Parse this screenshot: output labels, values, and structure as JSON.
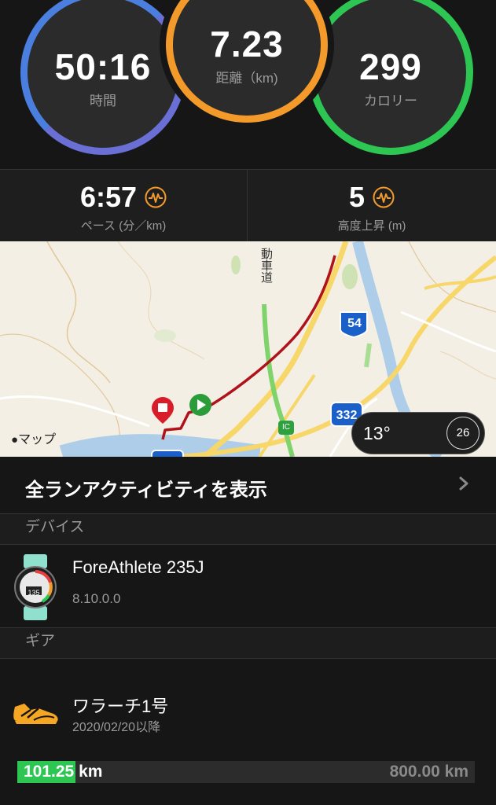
{
  "top_progress": 0.25,
  "summary": {
    "time": {
      "value": "50:16",
      "label": "時間"
    },
    "distance": {
      "value": "7.23",
      "label": "距離（km)"
    },
    "calories": {
      "value": "299",
      "label": "カロリー"
    }
  },
  "stats": {
    "pace": {
      "value": "6:57",
      "label": "ペース (分／km)",
      "icon": "elevation-wave-icon"
    },
    "elevation": {
      "value": "5",
      "label": "高度上昇 (m)",
      "icon": "elevation-wave-icon"
    }
  },
  "map": {
    "credit": "マップ",
    "road_labels": [
      "54",
      "332",
      "IC"
    ],
    "road_vertical_text": "動車道",
    "weather": {
      "temperature": "13°",
      "wind": "26"
    }
  },
  "all_activities_label": "全ランアクティビティを表示",
  "sections": {
    "device_header": "デバイス",
    "gear_header": "ギア"
  },
  "device": {
    "name": "ForeAthlete 235J",
    "version": "8.10.0.0",
    "watch_face_value": "135"
  },
  "gear": {
    "name": "ワラーチ1号",
    "since": "2020/02/20以降",
    "distance": "101.25 km",
    "max_distance": "800.00 km",
    "progress": 0.1266
  },
  "colors": {
    "time_ring": "#4a7fe0",
    "distance_ring": "#f39a2b",
    "calorie_ring": "#2dc653",
    "route": "#b0121b",
    "gear_fill": "#2dc653"
  }
}
